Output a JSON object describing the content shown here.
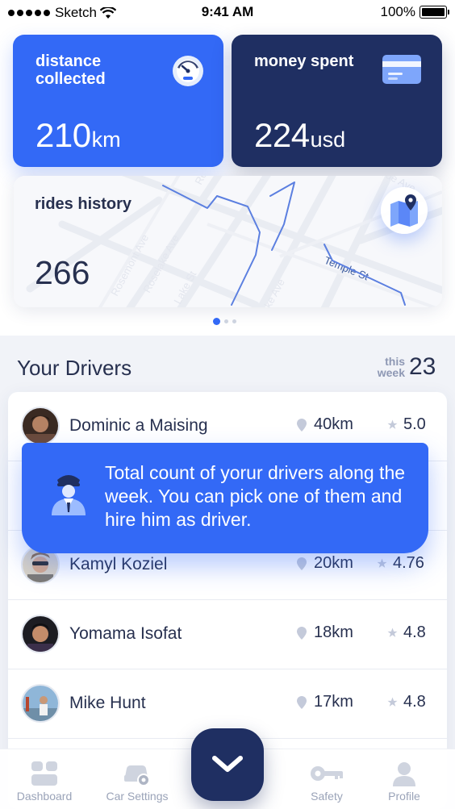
{
  "status_bar": {
    "carrier": "Sketch",
    "time": "9:41 AM",
    "battery": "100%"
  },
  "cards": {
    "distance": {
      "title": "distance collected",
      "value": "210",
      "unit": "km",
      "icon": "gauge-icon"
    },
    "money": {
      "title": "money spent",
      "value": "224",
      "unit": "usd",
      "icon": "credit-card-icon"
    },
    "rides": {
      "title": "rides history",
      "value": "266",
      "icon": "map-pin-icon"
    }
  },
  "map_labels": [
    "Rosemont Ave",
    "Roselake Ave",
    "Lake St",
    "Temple St",
    "Vue Ave",
    "ke Ave",
    "Re"
  ],
  "carousel": {
    "pages": 3,
    "active_index": 0
  },
  "drivers": {
    "title": "Your Drivers",
    "week_label": "this week",
    "week_count": "23",
    "items": [
      {
        "name": "Dominic a Maising",
        "distance": "40km",
        "rating": "5.0"
      },
      {
        "name": "Kamyl Koziel",
        "distance": "20km",
        "rating": "4.76"
      },
      {
        "name": "Yomama Isofat",
        "distance": "18km",
        "rating": "4.8"
      },
      {
        "name": "Mike Hunt",
        "distance": "17km",
        "rating": "4.8"
      }
    ]
  },
  "tooltip": {
    "text": "Total count of yorur drivers along the week. You can pick one of them and hire him as driver."
  },
  "nav": {
    "items": [
      {
        "label": "Dashboard",
        "icon": "dashboard-icon"
      },
      {
        "label": "Car Settings",
        "icon": "car-settings-icon"
      },
      {
        "label": "Safety",
        "icon": "key-icon"
      },
      {
        "label": "Profile",
        "icon": "profile-icon"
      }
    ],
    "center_icon": "chevron-down-icon"
  },
  "colors": {
    "primary": "#3369f6",
    "navy": "#1f2f62",
    "text": "#27304f",
    "muted": "#9aa3b8"
  }
}
